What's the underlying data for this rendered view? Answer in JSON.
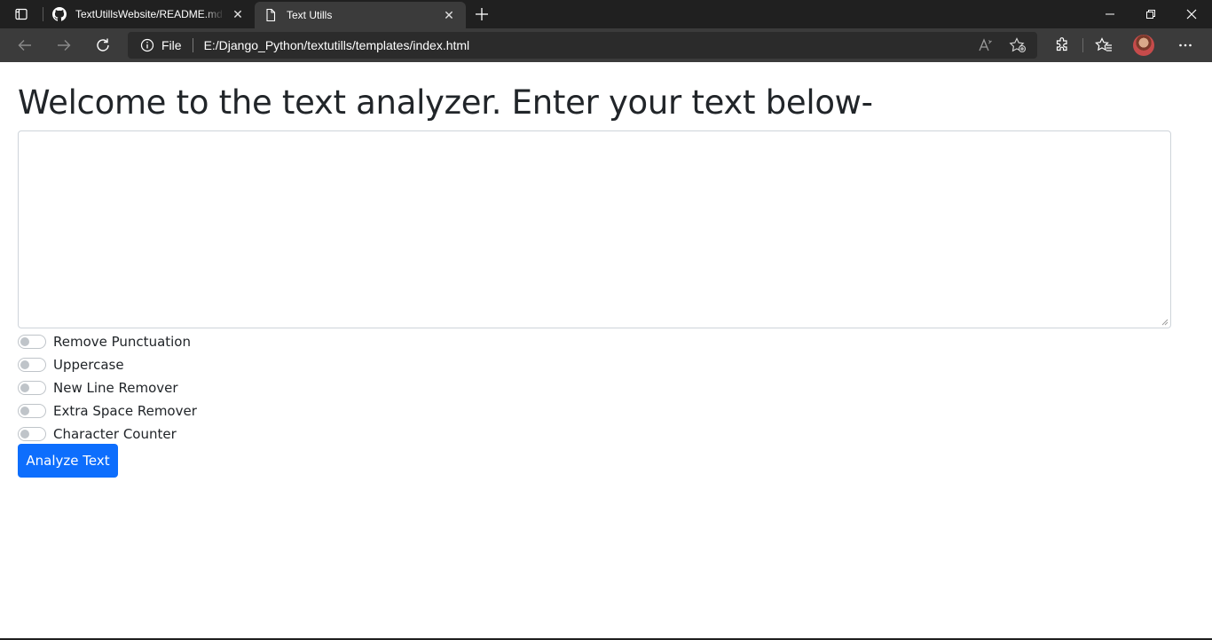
{
  "browser": {
    "tabs": [
      {
        "title": "TextUtillsWebsite/README.md at",
        "favicon": "github-icon",
        "active": false
      },
      {
        "title": "Text Utills",
        "favicon": "file-icon",
        "active": true
      }
    ],
    "address": {
      "scheme_label": "File",
      "url": "E:/Django_Python/textutills/templates/index.html"
    },
    "icons": {
      "read_aloud": "read-aloud-icon",
      "add_favorite": "add-favorite-icon",
      "extensions": "extensions-icon",
      "favorites": "favorites-icon",
      "more": "more-icon"
    }
  },
  "page": {
    "heading": "Welcome to the text analyzer. Enter your text below-",
    "textarea_value": "",
    "options": [
      {
        "label": "Remove Punctuation",
        "checked": false
      },
      {
        "label": "Uppercase",
        "checked": false
      },
      {
        "label": "New Line Remover",
        "checked": false
      },
      {
        "label": "Extra Space Remover",
        "checked": false
      },
      {
        "label": "Character Counter",
        "checked": false
      }
    ],
    "submit_label": "Analyze Text"
  },
  "colors": {
    "primary_button": "#0d6efd",
    "heading_text": "#212529",
    "chrome_dark": "#202020",
    "toolbar": "#3b3b3b"
  }
}
